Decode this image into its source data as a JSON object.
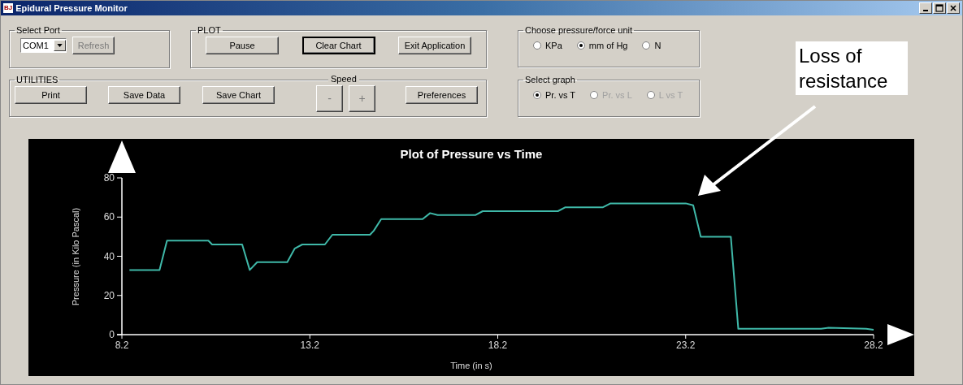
{
  "window": {
    "title": "Epidural Pressure Monitor",
    "app_icon": "BJ"
  },
  "port_group": {
    "title": "Select Port",
    "port": "COM1",
    "refresh": {
      "label": "Refresh",
      "disabled": true
    }
  },
  "plot_group": {
    "title": "PLOT",
    "buttons": [
      {
        "label": "Pause",
        "focused": false
      },
      {
        "label": "Clear Chart",
        "focused": true
      },
      {
        "label": "Exit Application",
        "focused": false
      }
    ]
  },
  "utilities_group": {
    "title": "UTILITIES",
    "speed_title": "Speed",
    "buttons": [
      {
        "label": "Print",
        "kind": "wide",
        "disabled": false
      },
      {
        "label": "Save Data",
        "kind": "wide",
        "disabled": false
      },
      {
        "label": "Save Chart",
        "kind": "wide",
        "disabled": false
      },
      {
        "label": "-",
        "kind": "speed",
        "disabled": true
      },
      {
        "label": "+",
        "kind": "speed",
        "disabled": true
      },
      {
        "label": "Preferences",
        "kind": "wide",
        "disabled": false
      }
    ]
  },
  "unit_group": {
    "title": "Choose pressure/force unit",
    "options": [
      {
        "label": "KPa",
        "selected": false,
        "disabled": false
      },
      {
        "label": "mm of Hg",
        "selected": true,
        "disabled": false
      },
      {
        "label": "N",
        "selected": false,
        "disabled": false
      }
    ]
  },
  "graph_group": {
    "title": "Select graph",
    "options": [
      {
        "label": "Pr. vs T",
        "selected": true,
        "disabled": false
      },
      {
        "label": "Pr. vs L",
        "selected": false,
        "disabled": true
      },
      {
        "label": "L vs T",
        "selected": false,
        "disabled": true
      }
    ]
  },
  "callout": {
    "text": "Loss of resistance"
  },
  "chart": {
    "chart_data": {
      "type": "line",
      "title": "Plot of Pressure vs Time",
      "xlabel": "Time (in s)",
      "ylabel": "Pressure (in Kilo Pascal)",
      "xlim": [
        8.2,
        28.2
      ],
      "ylim": [
        0,
        80
      ],
      "xticks": [
        {
          "value": 8.2,
          "label": "8.2"
        },
        {
          "value": 13.2,
          "label": "13.2"
        },
        {
          "value": 18.2,
          "label": "18.2"
        },
        {
          "value": 23.2,
          "label": "23.2"
        },
        {
          "value": 28.2,
          "label": "28.2"
        }
      ],
      "yticks": [
        0,
        20,
        40,
        60,
        80
      ],
      "x": [
        8.4,
        9.2,
        9.4,
        10.5,
        10.6,
        11.4,
        11.6,
        11.8,
        12.6,
        12.8,
        13.0,
        13.6,
        13.8,
        14.8,
        14.9,
        15.1,
        16.2,
        16.4,
        16.6,
        17.6,
        17.8,
        19.8,
        20.0,
        21.0,
        21.2,
        23.2,
        23.4,
        23.6,
        24.4,
        24.6,
        26.8,
        27.0,
        28.0,
        28.2
      ],
      "series": [
        {
          "color": "#3fb8a8",
          "values": [
            33,
            33,
            48,
            48,
            46,
            46,
            33,
            37,
            37,
            44,
            46,
            46,
            51,
            51,
            53,
            59,
            59,
            62,
            61,
            61,
            63,
            63,
            65,
            65,
            67,
            67,
            66,
            50,
            50,
            3,
            3,
            3.5,
            3,
            2.5
          ]
        }
      ]
    }
  }
}
